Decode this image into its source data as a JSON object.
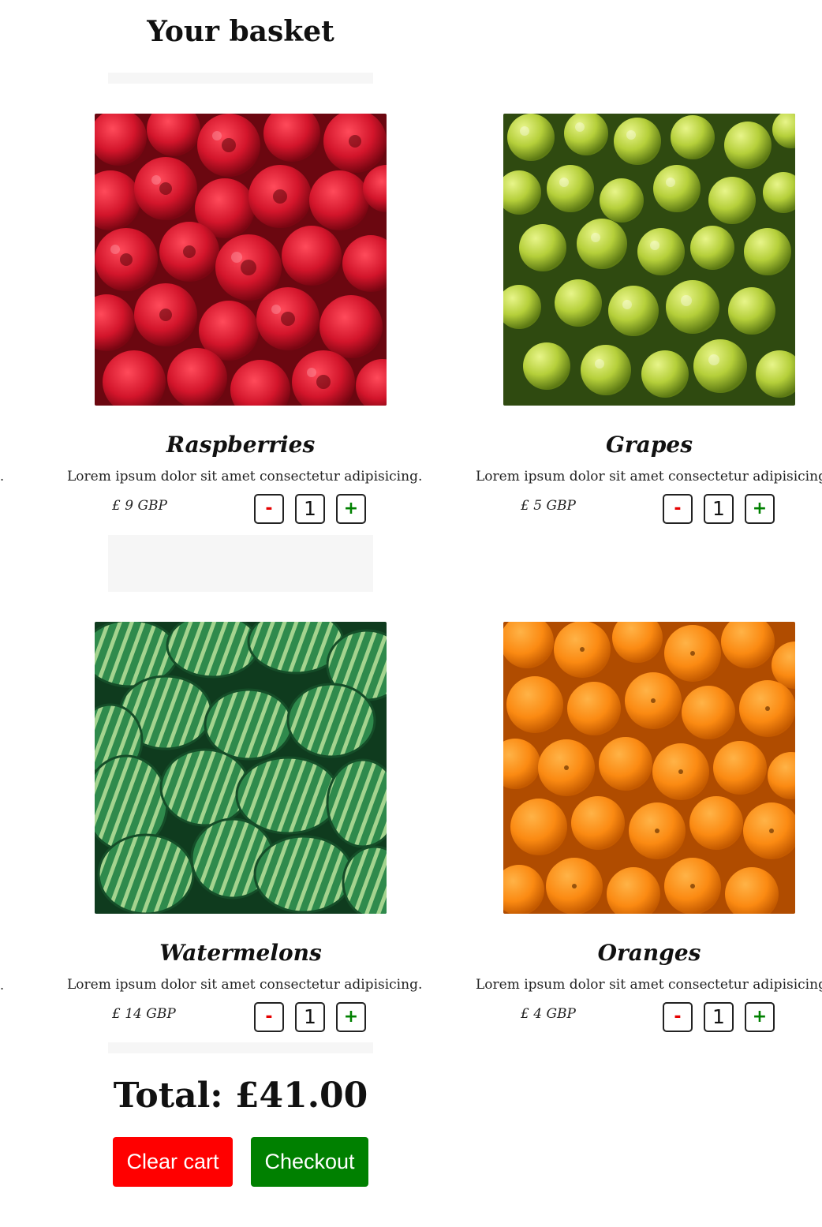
{
  "page": {
    "title": "Your basket",
    "edge_fragment": "."
  },
  "products": [
    {
      "name": "Raspberries",
      "image_icon": "raspberries-photo",
      "description": "Lorem ipsum dolor sit amet consectetur adipisicing.",
      "price": "£ 9 GBP",
      "quantity": "1",
      "minus_label": "-",
      "plus_label": "+"
    },
    {
      "name": "Grapes",
      "image_icon": "grapes-photo",
      "description": "Lorem ipsum dolor sit amet consectetur adipisicing.",
      "price": "£ 5 GBP",
      "quantity": "1",
      "minus_label": "-",
      "plus_label": "+"
    },
    {
      "name": "Watermelons",
      "image_icon": "watermelons-photo",
      "description": "Lorem ipsum dolor sit amet consectetur adipisicing.",
      "price": "£ 14 GBP",
      "quantity": "1",
      "minus_label": "-",
      "plus_label": "+"
    },
    {
      "name": "Oranges",
      "image_icon": "oranges-photo",
      "description": "Lorem ipsum dolor sit amet consectetur adipisicing.",
      "price": "£ 4 GBP",
      "quantity": "1",
      "minus_label": "-",
      "plus_label": "+"
    }
  ],
  "summary": {
    "total": "Total: £41.00",
    "clear_label": "Clear cart",
    "checkout_label": "Checkout"
  },
  "colors": {
    "minus": "#e60000",
    "plus": "#008000",
    "clear_button": "#ff0000",
    "checkout_button": "#008000"
  }
}
